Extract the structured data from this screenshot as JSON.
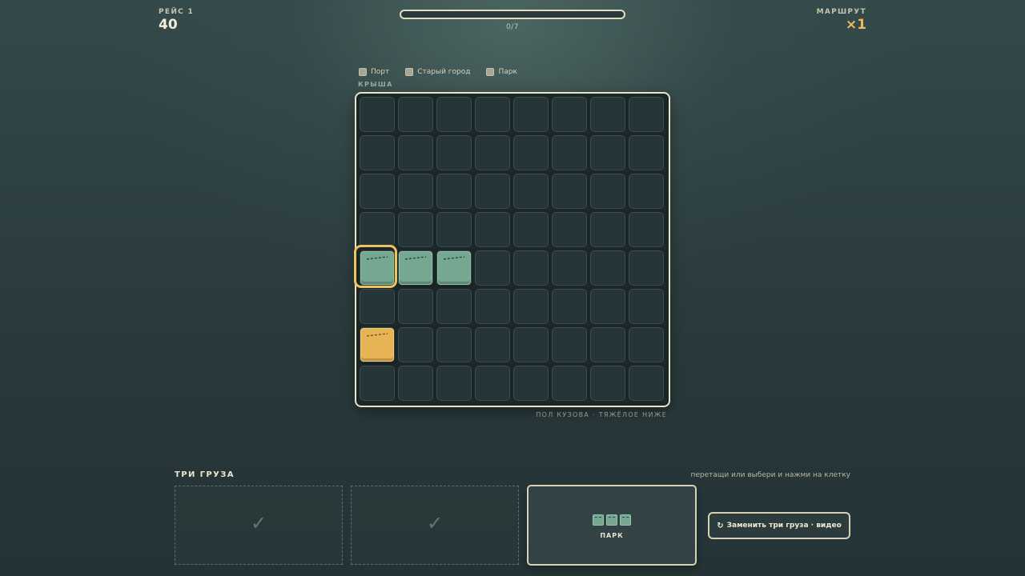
{
  "hud": {
    "run_label": "РЕЙС 1",
    "score": "40",
    "route_label": "МАРШРУТ",
    "multiplier": "×1",
    "progress_text": "0/7",
    "progress_value": 0,
    "progress_max": 7
  },
  "legend": [
    {
      "label": "Порт"
    },
    {
      "label": "Старый город"
    },
    {
      "label": "Парк"
    }
  ],
  "board": {
    "top_label": "КРЫША",
    "bottom_label": "ПОЛ КУЗОВА · ТЯЖЁЛОЕ НИЖЕ",
    "rows": 8,
    "cols": 8,
    "blocks": [
      {
        "row": 4,
        "col": 0,
        "kind": "green",
        "district": "Парк"
      },
      {
        "row": 4,
        "col": 1,
        "kind": "green",
        "district": "Парк"
      },
      {
        "row": 4,
        "col": 2,
        "kind": "green",
        "district": "Парк"
      },
      {
        "row": 6,
        "col": 0,
        "kind": "yellow",
        "district": "Порт"
      }
    ],
    "selected": {
      "row": 4,
      "col": 0
    }
  },
  "tray": {
    "title": "ТРИ ГРУЗА",
    "hint": "перетащи или выбери и нажми на клетку",
    "slots": [
      {
        "state": "used",
        "check": "✓"
      },
      {
        "state": "used",
        "check": "✓"
      },
      {
        "state": "active",
        "name": "ПАРК",
        "blocks": 3
      }
    ],
    "reroll_label": "Заменить три груза · видео",
    "reroll_icon": "↻"
  },
  "colors": {
    "green_block": "#76a791",
    "yellow_block": "#e7b455",
    "accent": "#efba55",
    "frame": "#ece3c4"
  }
}
